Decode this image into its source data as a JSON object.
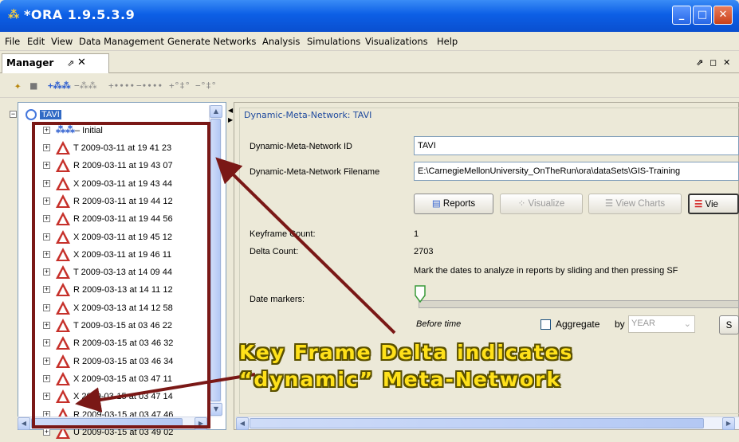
{
  "window": {
    "title": "*ORA 1.9.5.3.9"
  },
  "menu": [
    "File",
    "Edit",
    "View",
    "Data Management",
    "Generate Networks",
    "Analysis",
    "Simulations",
    "Visualizations",
    "Help"
  ],
  "manager": {
    "tab_label": "Manager",
    "pin": "⇗",
    "close": "✕"
  },
  "panel_controls": "⇗ ◻ ✕",
  "toolbar": {
    "items": [
      "wand",
      "save",
      "add-net",
      "del-net",
      "add-link",
      "del-link",
      "add-node",
      "del-node"
    ]
  },
  "tree": {
    "root": "TAVI",
    "initial": "– Initial",
    "items": [
      "T 2009-03-11 at 19 41 23",
      "R 2009-03-11 at 19 43 07",
      "X 2009-03-11 at 19 43 44",
      "R 2009-03-11 at 19 44 12",
      "R 2009-03-11 at 19 44 56",
      "X 2009-03-11 at 19 45 12",
      "X 2009-03-11 at 19 46 11",
      "T 2009-03-13 at 14 09 44",
      "R 2009-03-13 at 14 11 12",
      "X 2009-03-13 at 14 12 58",
      "T 2009-03-15 at 03 46 22",
      "R 2009-03-15 at 03 46 32",
      "R 2009-03-15 at 03 46 34",
      "X 2009-03-15 at 03 47 11",
      "X 2009-03-15 at 03 47 14",
      "R 2009-03-15 at 03 47 46",
      "U 2009-03-15 at 03 49 02"
    ]
  },
  "detail": {
    "title": "Dynamic-Meta-Network: TAVI",
    "id_label": "Dynamic-Meta-Network ID",
    "id_value": "TAVI",
    "filename_label": "Dynamic-Meta-Network Filename",
    "filename_value": "E:\\CarnegieMellonUniversity_OnTheRun\\ora\\dataSets\\GIS-Training",
    "buttons": {
      "reports": "Reports",
      "visualize": "Visualize",
      "view_charts": "View Charts",
      "view": "Vie"
    },
    "keyframe_label": "Keyframe Count:",
    "keyframe_value": "1",
    "delta_label": "Delta Count:",
    "delta_value": "2703",
    "instruction": "Mark the dates to analyze in reports by sliding and then pressing SF",
    "date_markers_label": "Date markers:",
    "before_time": "Before time",
    "aggregate_label": "Aggregate",
    "by_label": "by",
    "aggregate_unit": "YEAR",
    "s_button": "S"
  },
  "annotation": {
    "line1": "Key Frame Delta indicates",
    "line2": "“dynamic” Meta-Network"
  },
  "colors": {
    "accent": "#316ac5",
    "annotation": "#ffe11a",
    "overlay": "#7a1816",
    "triangle": "#c6302a"
  }
}
